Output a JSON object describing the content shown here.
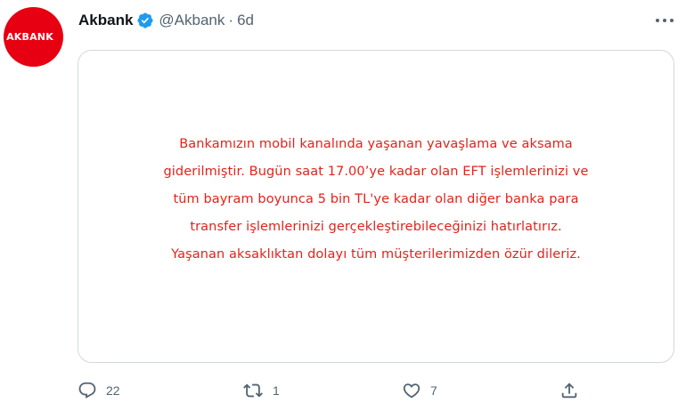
{
  "tweet": {
    "avatar_text": "AKBANK",
    "display_name": "Akbank",
    "handle": "@Akbank",
    "separator": "·",
    "time": "6d",
    "card_lines": [
      "Bankamızın mobil kanalında yaşanan yavaşlama ve aksama",
      "giderilmiştir. Bugün saat 17.00’ye kadar olan EFT işlemlerinizi ve",
      "tüm bayram boyunca 5 bin TL'ye kadar olan diğer banka para",
      "transfer işlemlerinizi gerçekleştirebileceğinizi hatırlatırız.",
      "Yaşanan aksaklıktan dolayı tüm müşterilerimizden özür dileriz."
    ],
    "actions": {
      "reply_count": "22",
      "retweet_count": "1",
      "like_count": "7"
    }
  },
  "colors": {
    "brand_red": "#e60012",
    "card_text": "#e2231a",
    "verified_blue": "#1d9bf0",
    "secondary_text": "#536471"
  },
  "icons": [
    "verified-badge-icon",
    "more-options-icon",
    "reply-icon",
    "retweet-icon",
    "like-icon",
    "share-icon"
  ]
}
